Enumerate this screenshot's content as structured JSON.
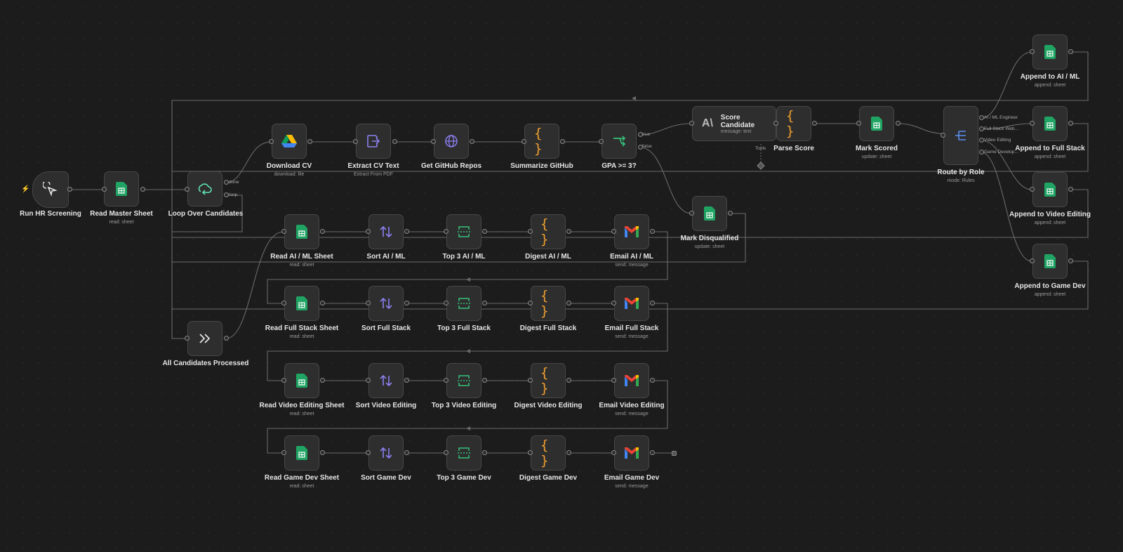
{
  "workflow": {
    "colors": {
      "background": "#1c1c1c",
      "node": "#2e2e2e",
      "edge": "#6a6a6a",
      "sheets_green": "#1fa463",
      "code_orange": "#f0a030",
      "purple": "#8b80f0",
      "trigger_accent": "#ff6d3a"
    },
    "nodes": {
      "run_hr_screening": {
        "label": "Run HR Screening",
        "icon": "cursor-click-icon"
      },
      "read_master_sheet": {
        "label": "Read Master Sheet",
        "sub": "read: sheet",
        "icon": "google-sheets-icon"
      },
      "loop_over_candidates": {
        "label": "Loop Over Candidates",
        "icon": "loop-icon",
        "out_done": "done",
        "out_loop": "loop"
      },
      "download_cv": {
        "label": "Download CV",
        "sub": "download: file",
        "icon": "google-drive-icon"
      },
      "extract_cv_text": {
        "label": "Extract CV Text",
        "sub": "Extract From PDF",
        "icon": "extract-icon"
      },
      "get_github_repos": {
        "label": "Get GitHub Repos",
        "icon": "globe-icon"
      },
      "summarize_github": {
        "label": "Summarize GitHub",
        "icon": "code-braces-icon"
      },
      "gpa_check": {
        "label": "GPA >= 3?",
        "icon": "branch-icon",
        "out_true": "true",
        "out_false": "false"
      },
      "score_candidate": {
        "label": "Score Candidate",
        "sub": "message: text",
        "icon": "anthropic-icon",
        "tool_label": "Tools"
      },
      "parse_score": {
        "label": "Parse Score",
        "icon": "code-braces-icon"
      },
      "mark_scored": {
        "label": "Mark Scored",
        "sub": "update: sheet",
        "icon": "google-sheets-icon"
      },
      "route_by_role": {
        "label": "Route by Role",
        "sub": "mode: Rules",
        "icon": "router-icon",
        "outputs": [
          "AI / ML Engineer",
          "Full Stack Web...",
          "Video Editing",
          "Game Develop..."
        ]
      },
      "append_ai_ml": {
        "label": "Append to AI / ML",
        "sub": "append: sheet",
        "icon": "google-sheets-icon"
      },
      "append_full_stack": {
        "label": "Append to Full Stack",
        "sub": "append: sheet",
        "icon": "google-sheets-icon"
      },
      "append_video_editing": {
        "label": "Append to Video Editing",
        "sub": "append: sheet",
        "icon": "google-sheets-icon"
      },
      "append_game_dev": {
        "label": "Append to Game Dev",
        "sub": "append: sheet",
        "icon": "google-sheets-icon"
      },
      "mark_disqualified": {
        "label": "Mark Disqualified",
        "sub": "update: sheet",
        "icon": "google-sheets-icon"
      },
      "all_candidates_processed": {
        "label": "All Candidates Processed",
        "icon": "double-chevron-icon"
      },
      "read_ai_ml_sheet": {
        "label": "Read AI / ML Sheet",
        "sub": "read: sheet",
        "icon": "google-sheets-icon"
      },
      "sort_ai_ml": {
        "label": "Sort AI / ML",
        "icon": "sort-icon"
      },
      "top3_ai_ml": {
        "label": "Top 3 AI / ML",
        "icon": "limit-icon"
      },
      "digest_ai_ml": {
        "label": "Digest AI / ML",
        "icon": "code-braces-icon"
      },
      "email_ai_ml": {
        "label": "Email AI / ML",
        "sub": "send: message",
        "icon": "gmail-icon"
      },
      "read_full_stack_sheet": {
        "label": "Read Full Stack Sheet",
        "sub": "read: sheet",
        "icon": "google-sheets-icon"
      },
      "sort_full_stack": {
        "label": "Sort Full Stack",
        "icon": "sort-icon"
      },
      "top3_full_stack": {
        "label": "Top 3 Full Stack",
        "icon": "limit-icon"
      },
      "digest_full_stack": {
        "label": "Digest Full Stack",
        "icon": "code-braces-icon"
      },
      "email_full_stack": {
        "label": "Email Full Stack",
        "sub": "send: message",
        "icon": "gmail-icon"
      },
      "read_video_editing_sheet": {
        "label": "Read Video Editing Sheet",
        "sub": "read: sheet",
        "icon": "google-sheets-icon"
      },
      "sort_video_editing": {
        "label": "Sort Video Editing",
        "icon": "sort-icon"
      },
      "top3_video_editing": {
        "label": "Top 3 Video Editing",
        "icon": "limit-icon"
      },
      "digest_video_editing": {
        "label": "Digest Video Editing",
        "icon": "code-braces-icon"
      },
      "email_video_editing": {
        "label": "Email Video Editing",
        "sub": "send: message",
        "icon": "gmail-icon"
      },
      "read_game_dev_sheet": {
        "label": "Read Game Dev Sheet",
        "sub": "read: sheet",
        "icon": "google-sheets-icon"
      },
      "sort_game_dev": {
        "label": "Sort Game Dev",
        "icon": "sort-icon"
      },
      "top3_game_dev": {
        "label": "Top 3 Game Dev",
        "icon": "limit-icon"
      },
      "digest_game_dev": {
        "label": "Digest Game Dev",
        "icon": "code-braces-icon"
      },
      "email_game_dev": {
        "label": "Email Game Dev",
        "sub": "send: message",
        "icon": "gmail-icon"
      }
    }
  }
}
